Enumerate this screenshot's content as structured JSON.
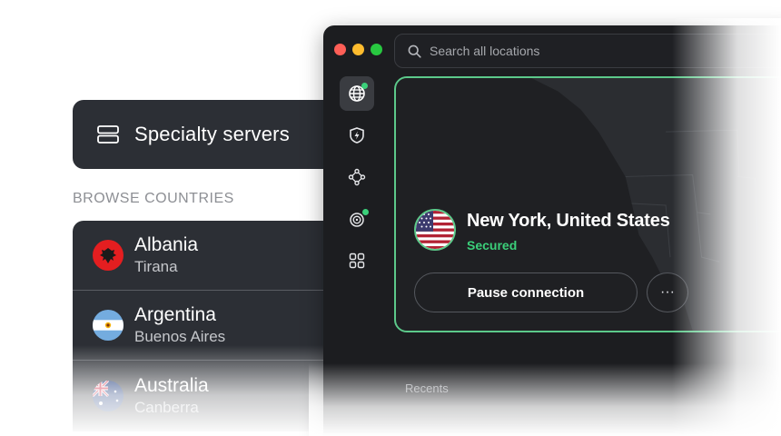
{
  "specialty": {
    "label": "Specialty servers",
    "icon": "server-icon"
  },
  "browse_heading": "BROWSE COUNTRIES",
  "countries": [
    {
      "name": "Albania",
      "city": "Tirana",
      "icon": "albania-flag-icon"
    },
    {
      "name": "Argentina",
      "city": "Buenos Aires",
      "icon": "argentina-flag-icon"
    },
    {
      "name": "Australia",
      "city": "Canberra",
      "icon": "australia-flag-icon"
    }
  ],
  "window": {
    "controls": [
      "close",
      "minimize",
      "zoom"
    ],
    "search": {
      "placeholder": "Search all locations",
      "value": ""
    },
    "sidebar": [
      {
        "id": "locations",
        "icon": "globe-icon",
        "active": true,
        "status_dot": true
      },
      {
        "id": "protection",
        "icon": "shield-bolt-icon",
        "active": false,
        "status_dot": false
      },
      {
        "id": "network",
        "icon": "mesh-network-icon",
        "active": false,
        "status_dot": false
      },
      {
        "id": "threat-monitor",
        "icon": "radar-icon",
        "active": false,
        "status_dot": true
      },
      {
        "id": "more-apps",
        "icon": "apps-grid-icon",
        "active": false,
        "status_dot": false
      }
    ],
    "connection": {
      "location": "New York, United States",
      "status": "Secured",
      "flag": "usa-flag-icon",
      "pause_label": "Pause connection",
      "more_label": "···"
    },
    "recents_label": "Recents"
  },
  "colors": {
    "window_bg": "#1c1d20",
    "panel_bg": "#2c2f35",
    "accent_green": "#3bd07a",
    "card_border": "#5cc98a",
    "muted_text": "#8d8f94"
  }
}
